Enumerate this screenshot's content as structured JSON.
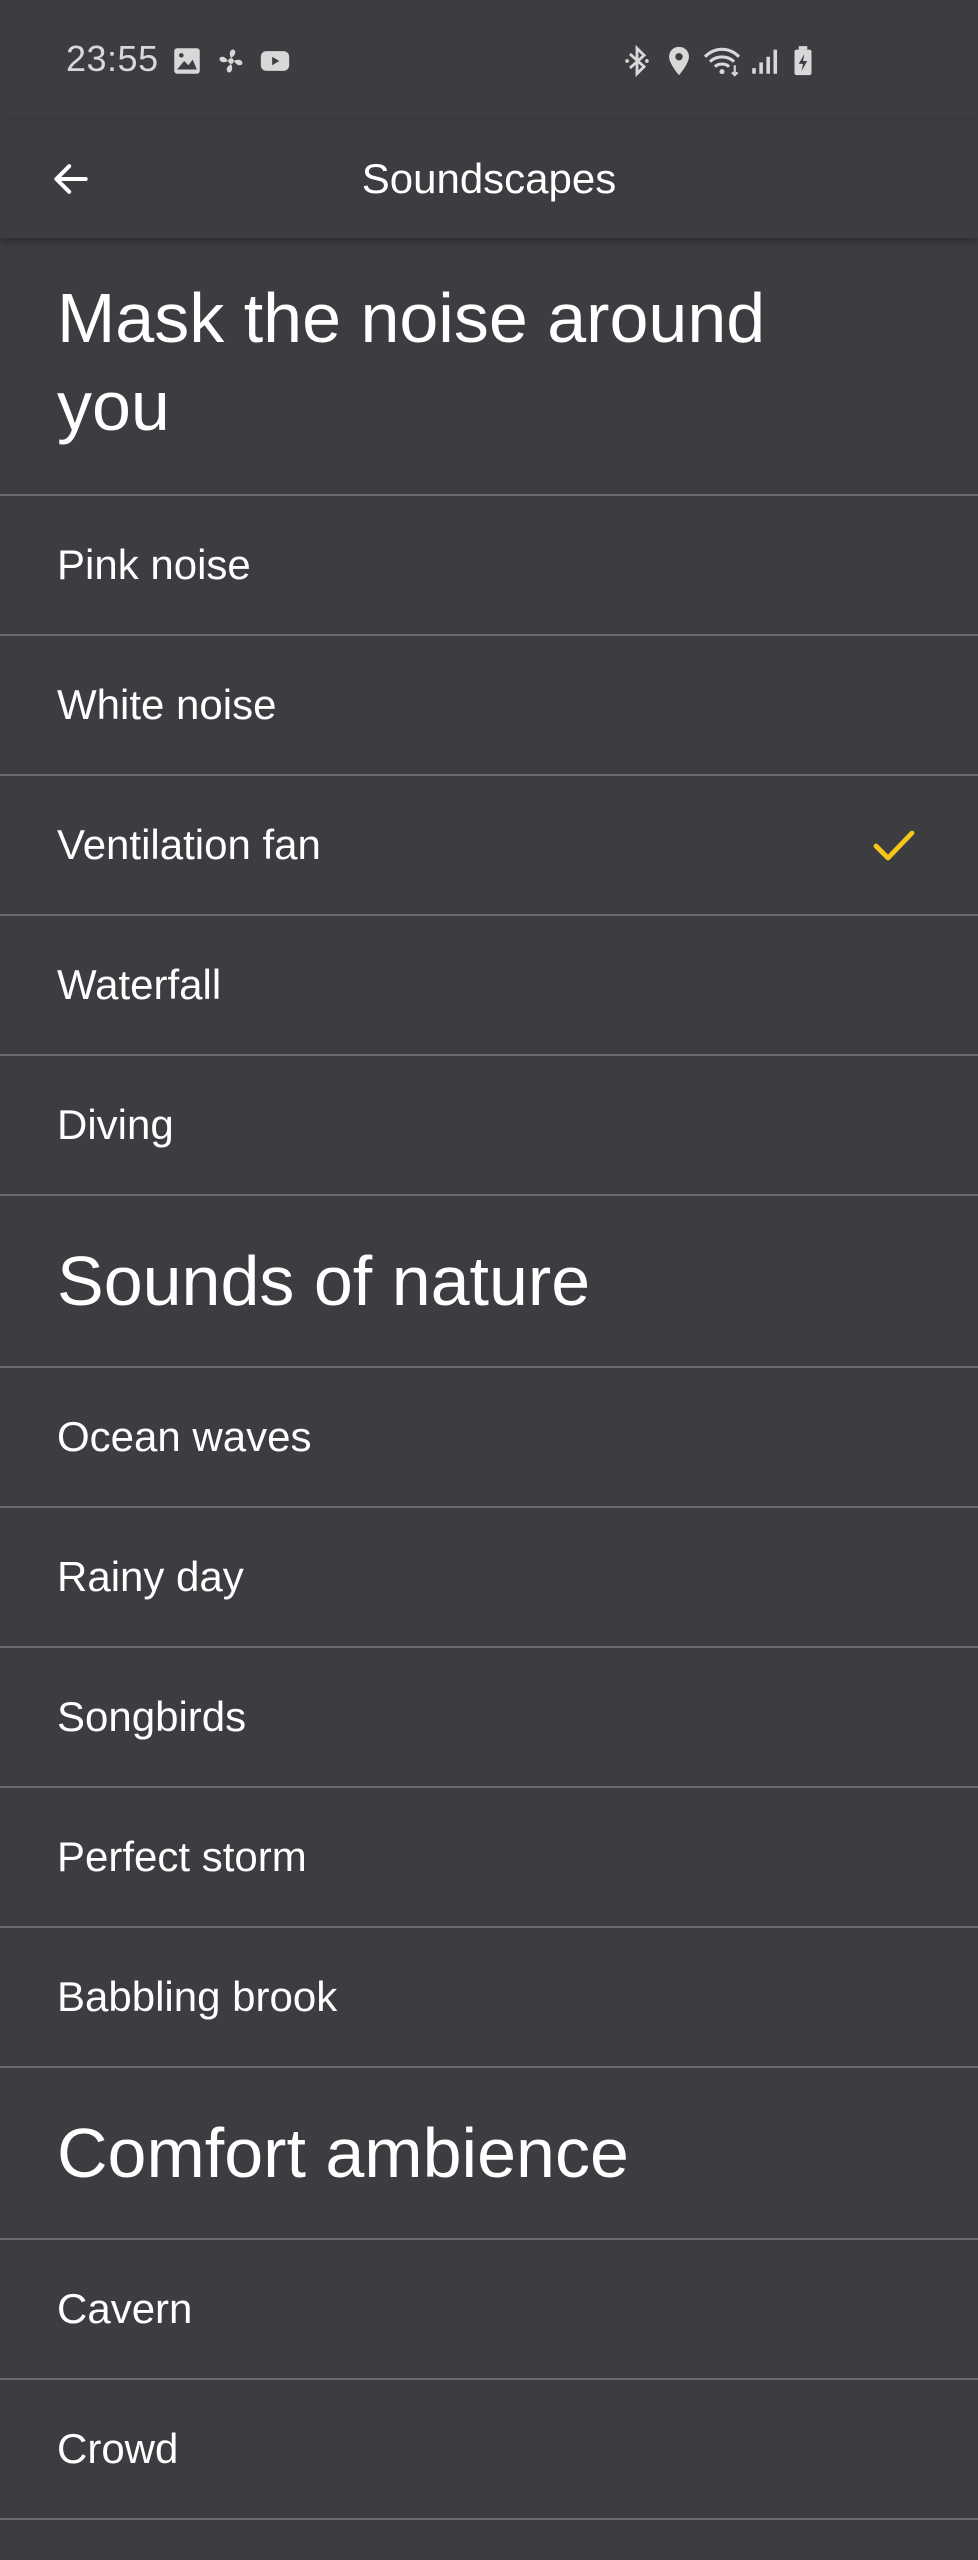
{
  "status_bar": {
    "time": "23:55",
    "left_icons": [
      "image-icon",
      "fan-icon",
      "youtube-icon"
    ],
    "right_icons": [
      "bluetooth-icon",
      "location-icon",
      "wifi-icon",
      "signal-icon",
      "battery-charging-icon"
    ]
  },
  "appbar": {
    "title": "Soundscapes",
    "back_icon": "arrow-left-icon"
  },
  "accent_color": "#f5c518",
  "sections": [
    {
      "title": "Mask the noise around you",
      "items": [
        {
          "label": "Pink noise",
          "selected": false
        },
        {
          "label": "White noise",
          "selected": false
        },
        {
          "label": "Ventilation fan",
          "selected": true
        },
        {
          "label": "Waterfall",
          "selected": false
        },
        {
          "label": "Diving",
          "selected": false
        }
      ]
    },
    {
      "title": "Sounds of nature",
      "items": [
        {
          "label": "Ocean waves",
          "selected": false
        },
        {
          "label": "Rainy day",
          "selected": false
        },
        {
          "label": "Songbirds",
          "selected": false
        },
        {
          "label": "Perfect storm",
          "selected": false
        },
        {
          "label": "Babbling brook",
          "selected": false
        }
      ]
    },
    {
      "title": "Comfort ambience",
      "items": [
        {
          "label": "Cavern",
          "selected": false
        },
        {
          "label": "Crowd",
          "selected": false
        }
      ]
    }
  ]
}
